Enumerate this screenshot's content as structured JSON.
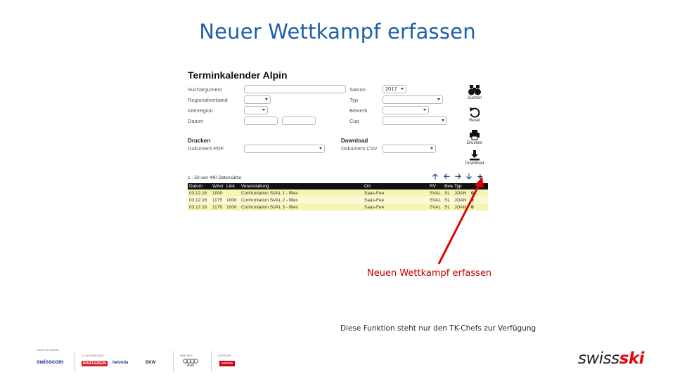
{
  "slide": {
    "title": "Neuer Wettkampf erfassen"
  },
  "app": {
    "heading": "Terminkalender Alpin",
    "filters": {
      "suchargument": "Suchargument",
      "regionalverband": "Regionalverband",
      "interregion": "Interregion",
      "datum": "Datum",
      "saison": "Saison",
      "saison_value": "2017",
      "typ": "Typ",
      "bewerb": "Bewerb",
      "cup": "Cup"
    },
    "drucken": {
      "title": "Drucken",
      "label": "Dokument PDF"
    },
    "download": {
      "title": "Download",
      "label": "Dokument CSV"
    },
    "tools": {
      "search": "Suchen",
      "reset": "Reset",
      "print": "Drucken",
      "download": "Download"
    },
    "record_count": "1 - 50 von 440 Datensätze",
    "nav": {
      "up": "🡡",
      "left": "🡠",
      "right": "🡢",
      "down": "🡣",
      "add": "+"
    },
    "table": {
      "headers": [
        "Datum",
        "WAnr",
        "Link",
        "Veranstaltung",
        "Ort",
        "RV",
        "Bew",
        "Typ"
      ],
      "rows": [
        [
          "03.12.16",
          "1000",
          "",
          "Confrontation SVAL 1 - filles",
          "Saas-Fee",
          "SVAL",
          "SL",
          "JOAN",
          "0"
        ],
        [
          "03.12.16",
          "1175",
          "1000",
          "Confrontation SVAL 2 - filles",
          "Saas-Fee",
          "SVAL",
          "SL",
          "JOAN",
          "0"
        ],
        [
          "03.12.16",
          "1176",
          "1000",
          "Confrontation SVAL 3 - filles",
          "Saas-Fee",
          "SVAL",
          "SL",
          "JOAN",
          "0"
        ]
      ]
    }
  },
  "annotation": {
    "callout": "Neuen Wettkampf erfassen",
    "note": "Diese Funktion steht nur den TK-Chefs zur Verfügung",
    "color": "#e00000"
  },
  "sponsors": {
    "labels": {
      "main": "HAUPTSPONSOR",
      "co": "CO-SPONSOREN",
      "partner": "PARTNER",
      "supplier": "SUPPLIER"
    },
    "logos": {
      "swisscom": "swisscom",
      "raiffeisen": "RAIFFEISEN",
      "helvetia": "helvetia",
      "bkw": "BKW",
      "audi": "Audi",
      "sunrise": "sunrise"
    }
  },
  "brand": {
    "part1": "swiss",
    "part2": "ski"
  }
}
